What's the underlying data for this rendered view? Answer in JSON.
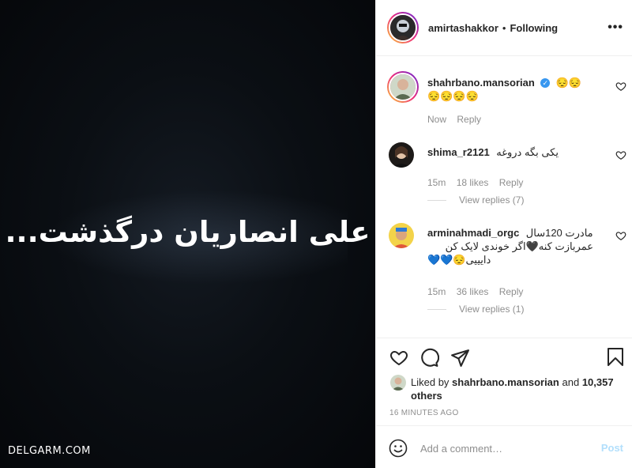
{
  "media": {
    "headline": "علی انصاریان درگذشت...",
    "watermark": "DELGARM.COM"
  },
  "header": {
    "username": "amirtashakkor",
    "separator": "•",
    "follow_status": "Following",
    "more": "•••"
  },
  "comments": [
    {
      "username": "shahrbano.mansorian",
      "verified": true,
      "text": "😔😔😔😔😔😔",
      "time": "Now",
      "reply": "Reply"
    },
    {
      "username": "shima_r2121",
      "text": "یکی بگه دروغه",
      "time": "15m",
      "likes": "18 likes",
      "reply": "Reply",
      "view_replies": "View replies (7)"
    },
    {
      "username": "arminahmadi_orgc",
      "text_line1": "مادرت 120سال",
      "text_line2": "عمربازت کنه🖤اگر خوندی لایک کن",
      "text_line3": "دایییی😔💙💙",
      "time": "15m",
      "likes": "36 likes",
      "reply": "Reply",
      "view_replies": "View replies (1)"
    }
  ],
  "likes": {
    "prefix": "Liked by",
    "user": "shahrbano.mansorian",
    "and": "and",
    "others": "10,357 others"
  },
  "timestamp": "16 MINUTES AGO",
  "add_comment": {
    "placeholder": "Add a comment…",
    "post": "Post"
  },
  "colors": {
    "accent": "#3897f0",
    "post_disabled": "#b2dffc",
    "muted": "#8e8e8e"
  }
}
